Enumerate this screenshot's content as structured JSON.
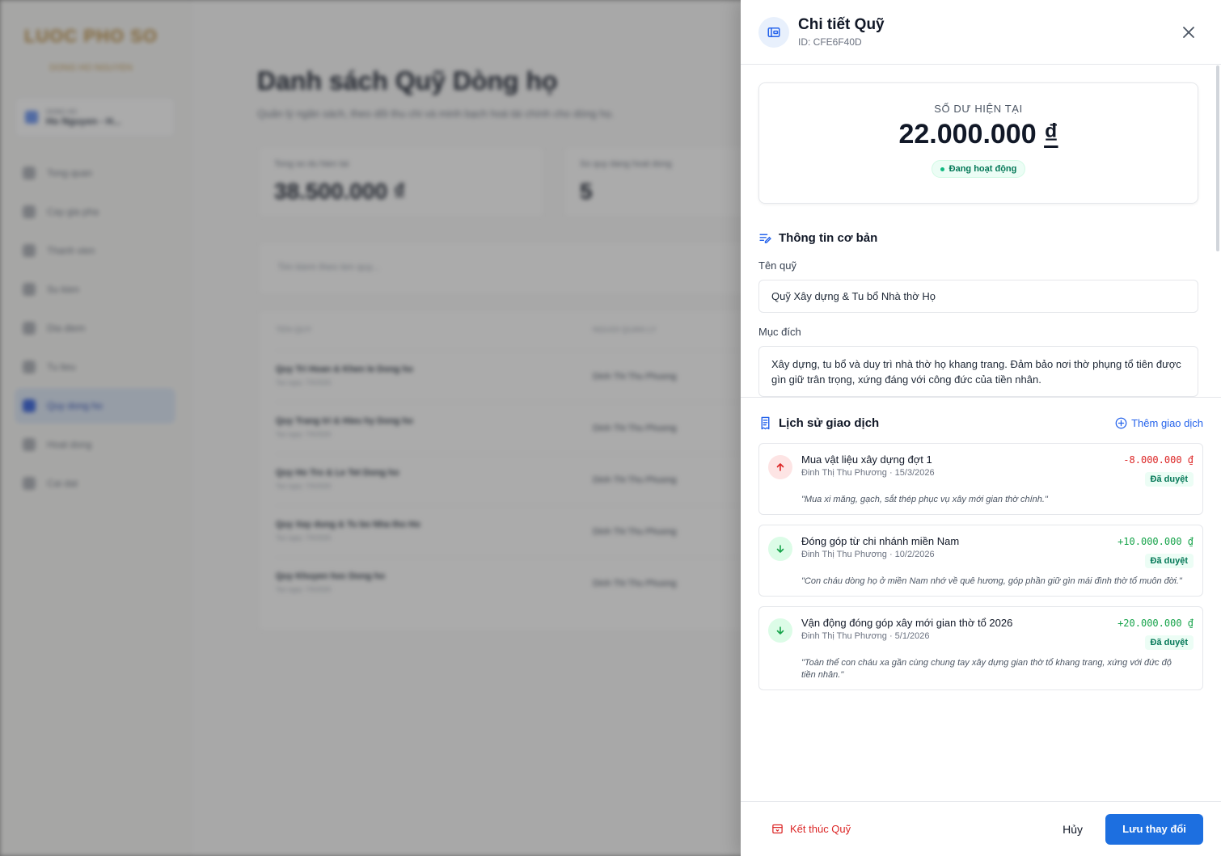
{
  "background": {
    "logo": "LUOC PHO SO",
    "logo_sub": "DONG HO NGUYEN",
    "clan_small": "DONG HO",
    "clan_name": "Ho Nguyen - H...",
    "nav": [
      "Tong quan",
      "Cay gia pha",
      "Thanh vien",
      "Su kien",
      "Dia diem",
      "Tu lieu",
      "Quy dong ho",
      "Hoat dong",
      "Cai dat"
    ],
    "page_title": "Danh sách Quỹ Dòng họ",
    "page_subtitle": "Quản lý ngân sách, theo dõi thu chi và minh bạch hoá tài chính cho dòng họ.",
    "stat1_label": "Tong so du hien tai",
    "stat1_value": "38.500.000 ₫",
    "stat2_label": "So quy dang hoat dong",
    "stat2_value": "5",
    "search_placeholder": "Tim kiem theo ten quy...",
    "col1": "TEN QUY",
    "col2": "NGUOI QUAN LY",
    "rows": [
      {
        "name": "Quy Tri Hoan & Khen le Dong ho",
        "date": "Tao ngay: 7/5/2026",
        "manager": "Dinh Thi Thu Phuong"
      },
      {
        "name": "Quy Trang tri & Hieu hy Dong ho",
        "date": "Tao ngay: 7/5/2026",
        "manager": "Dinh Thi Thu Phuong"
      },
      {
        "name": "Quy Ho Tro & Le Tet Dong ho",
        "date": "Tao ngay: 7/5/2026",
        "manager": "Dinh Thi Thu Phuong"
      },
      {
        "name": "Quy Xay dung & Tu bo Nha tho Ho",
        "date": "Tao ngay: 7/5/2026",
        "manager": "Dinh Thi Thu Phuong"
      },
      {
        "name": "Quy Khuyen hoc Dong ho",
        "date": "Tao ngay: 7/5/2026",
        "manager": "Dinh Thi Thu Phuong"
      }
    ]
  },
  "drawer": {
    "title": "Chi tiết Quỹ",
    "id": "ID: CFE6F40D",
    "balance_label": "SỐ DƯ HIỆN TẠI",
    "balance_amount": "22.000.000",
    "balance_currency": "₫",
    "status": "Đang hoạt động",
    "basic_info_title": "Thông tin cơ bản",
    "name_label": "Tên quỹ",
    "name_value": "Quỹ Xây dựng & Tu bổ Nhà thờ Họ",
    "purpose_label": "Mục đích",
    "purpose_value": "Xây dựng, tu bổ và duy trì nhà thờ họ khang trang. Đảm bảo nơi thờ phụng tổ tiên được gìn giữ trân trọng, xứng đáng với công đức của tiền nhân.",
    "history_title": "Lịch sử giao dịch",
    "add_tx": "Thêm giao dịch",
    "transactions": [
      {
        "title": "Mua vật liệu xây dựng đợt 1",
        "meta": "Đinh Thị Thu Phương · 15/3/2026",
        "amount": "-8.000.000 ₫",
        "status": "Đã duyệt",
        "note": "\"Mua xi măng, gạch, sắt thép phục vụ xây mới gian thờ chính.\""
      },
      {
        "title": "Đóng góp từ chi nhánh miền Nam",
        "meta": "Đinh Thị Thu Phương · 10/2/2026",
        "amount": "+10.000.000 ₫",
        "status": "Đã duyệt",
        "note": "\"Con cháu dòng họ ở miền Nam nhớ về quê hương, góp phần giữ gìn mái đình thờ tổ muôn đời.\""
      },
      {
        "title": "Vận động đóng góp xây mới gian thờ tổ 2026",
        "meta": "Đinh Thị Thu Phương · 5/1/2026",
        "amount": "+20.000.000 ₫",
        "status": "Đã duyệt",
        "note": "\"Toàn thể con cháu xa gần cùng chung tay xây dựng gian thờ tổ khang trang, xứng với đức độ tiền nhân.\""
      }
    ],
    "end_fund": "Kết thúc Quỹ",
    "cancel": "Hủy",
    "save": "Lưu thay đổi"
  },
  "colors": {
    "primary": "#1d6fe0",
    "danger": "#dc2626",
    "success": "#16a34a"
  }
}
